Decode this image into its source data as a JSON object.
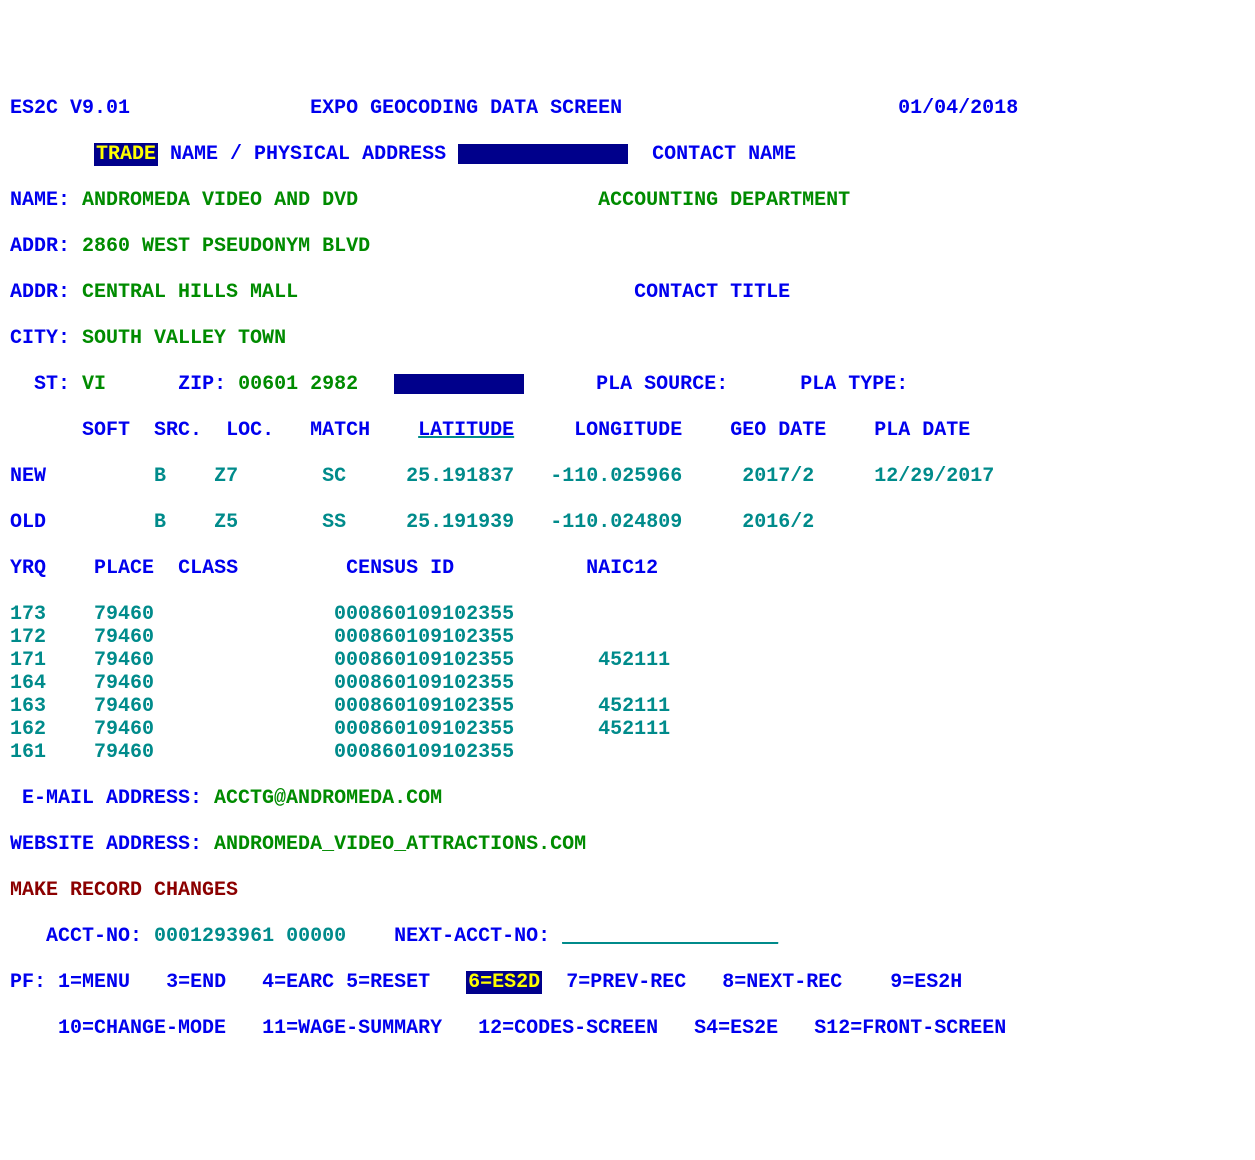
{
  "header": {
    "screen_id": "ES2C V9.01",
    "title": "EXPO GEOCODING DATA SCREEN",
    "date": "01/04/2018"
  },
  "section_header": {
    "trade_label": "TRADE",
    "name_addr_label": " NAME / PHYSICAL ADDRESS ",
    "contact_name_label": "CONTACT NAME"
  },
  "fields": {
    "name_label": "NAME:",
    "name_value": "ANDROMEDA VIDEO AND DVD",
    "contact_dept": "ACCOUNTING DEPARTMENT",
    "addr1_label": "ADDR:",
    "addr1_value": "2860 WEST PSEUDONYM BLVD",
    "addr2_label": "ADDR:",
    "addr2_value": "CENTRAL HILLS MALL",
    "contact_title_label": "CONTACT TITLE",
    "city_label": "CITY:",
    "city_value": "SOUTH VALLEY TOWN",
    "st_label": "ST:",
    "st_value": "VI",
    "zip_label": "ZIP:",
    "zip_value": "00601 2982",
    "pla_source_label": "PLA SOURCE:",
    "pla_type_label": "PLA TYPE:"
  },
  "geo_headers": {
    "soft": "SOFT",
    "src": "SRC.",
    "loc": "LOC.",
    "match": "MATCH",
    "latitude": "LATITUDE",
    "longitude": "LONGITUDE",
    "geo_date": "GEO DATE",
    "pla_date": "PLA DATE"
  },
  "geo_rows": {
    "new": {
      "label": "NEW",
      "soft": "B",
      "src": "Z7",
      "match": "SC",
      "lat": "25.191837",
      "lon": "-110.025966",
      "geo_date": "2017/2",
      "pla_date": "12/29/2017"
    },
    "old": {
      "label": "OLD",
      "soft": "B",
      "src": "Z5",
      "match": "SS",
      "lat": "25.191939",
      "lon": "-110.024809",
      "geo_date": "2016/2",
      "pla_date": ""
    }
  },
  "yrq_headers": {
    "yrq": "YRQ",
    "place": "PLACE",
    "class": "CLASS",
    "census": "CENSUS ID",
    "naic": "NAIC12"
  },
  "yrq_rows": [
    {
      "yrq": "173",
      "place": "79460",
      "census": "000860109102355",
      "naic": ""
    },
    {
      "yrq": "172",
      "place": "79460",
      "census": "000860109102355",
      "naic": ""
    },
    {
      "yrq": "171",
      "place": "79460",
      "census": "000860109102355",
      "naic": "452111"
    },
    {
      "yrq": "164",
      "place": "79460",
      "census": "000860109102355",
      "naic": ""
    },
    {
      "yrq": "163",
      "place": "79460",
      "census": "000860109102355",
      "naic": "452111"
    },
    {
      "yrq": "162",
      "place": "79460",
      "census": "000860109102355",
      "naic": "452111"
    },
    {
      "yrq": "161",
      "place": "79460",
      "census": "000860109102355",
      "naic": ""
    }
  ],
  "contact": {
    "email_label": " E-MAIL ADDRESS:",
    "email_value": "ACCTG@ANDROMEDA.COM",
    "website_label": "WEBSITE ADDRESS:",
    "website_value": "ANDROMEDA_VIDEO_ATTRACTIONS.COM"
  },
  "footer": {
    "make_changes": "MAKE RECORD CHANGES",
    "acct_no_label": "ACCT-NO:",
    "acct_no_value": "0001293961 00000",
    "next_acct_label": "NEXT-ACCT-NO:",
    "next_acct_underline": "____________ _____"
  },
  "pf": {
    "prefix": "PF:",
    "k1": "1=MENU",
    "k3": "3=END",
    "k4": "4=EARC",
    "k5": "5=RESET",
    "k6": "6=ES2D",
    "k7": "7=PREV-REC",
    "k8": "8=NEXT-REC",
    "k9": "9=ES2H",
    "k10": "10=CHANGE-MODE",
    "k11": "11=WAGE-SUMMARY",
    "k12": "12=CODES-SCREEN",
    "s4": "S4=ES2E",
    "s12": "S12=FRONT-SCREEN"
  }
}
